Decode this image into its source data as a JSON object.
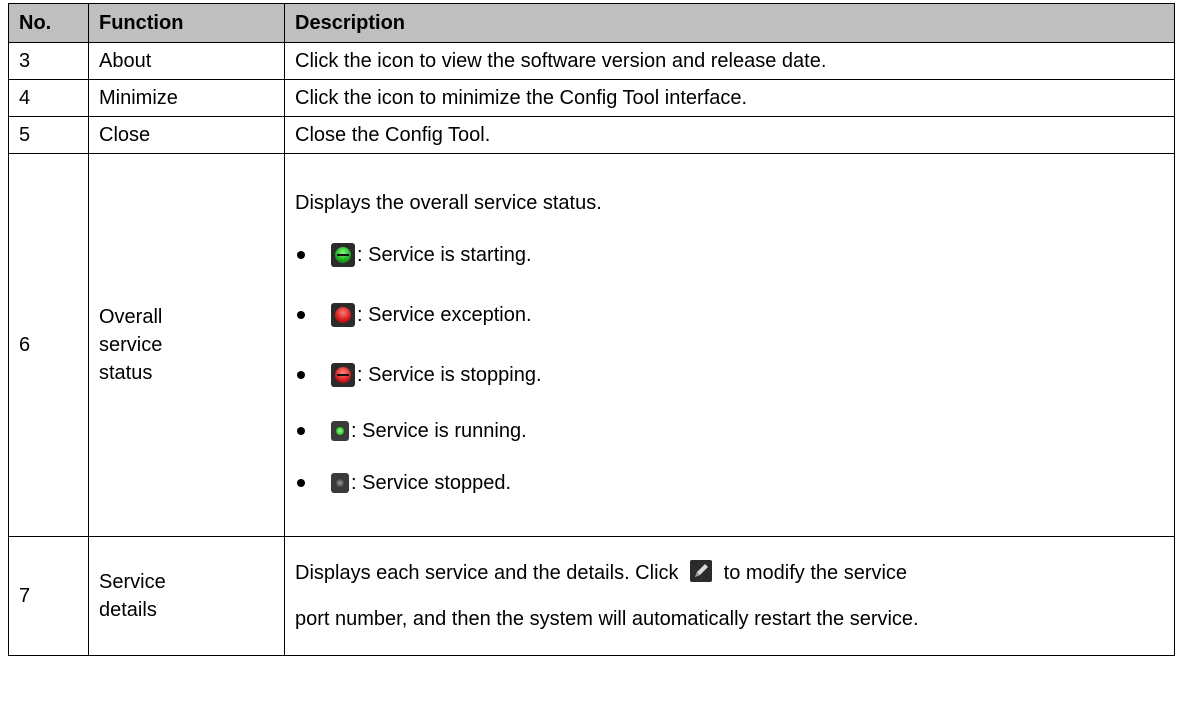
{
  "headers": {
    "no": "No.",
    "function": "Function",
    "description": "Description"
  },
  "rows": [
    {
      "no": "3",
      "function": "About",
      "description": "Click the icon to view the software version and release date."
    },
    {
      "no": "4",
      "function": "Minimize",
      "description": "Click the icon to minimize the Config Tool interface."
    },
    {
      "no": "5",
      "function": "Close",
      "description": "Close the Config Tool."
    },
    {
      "no": "6",
      "function_lines": [
        "Overall",
        "service",
        "status"
      ],
      "intro": "Displays the overall service status.",
      "statuses": [
        {
          "icon": "service-starting-icon",
          "text": ": Service is starting."
        },
        {
          "icon": "service-exception-icon",
          "text": ": Service exception."
        },
        {
          "icon": "service-stopping-icon",
          "text": ": Service is stopping."
        },
        {
          "icon": "service-running-icon",
          "text": ": Service is running."
        },
        {
          "icon": "service-stopped-icon",
          "text": ": Service stopped."
        }
      ]
    },
    {
      "no": "7",
      "function_lines": [
        "Service",
        "details"
      ],
      "desc_before_icon": "Displays each service and the details. Click",
      "desc_icon": "edit-icon",
      "desc_after_icon": "to modify the service",
      "desc_line2": "port number, and then the system will automatically restart the service."
    }
  ]
}
